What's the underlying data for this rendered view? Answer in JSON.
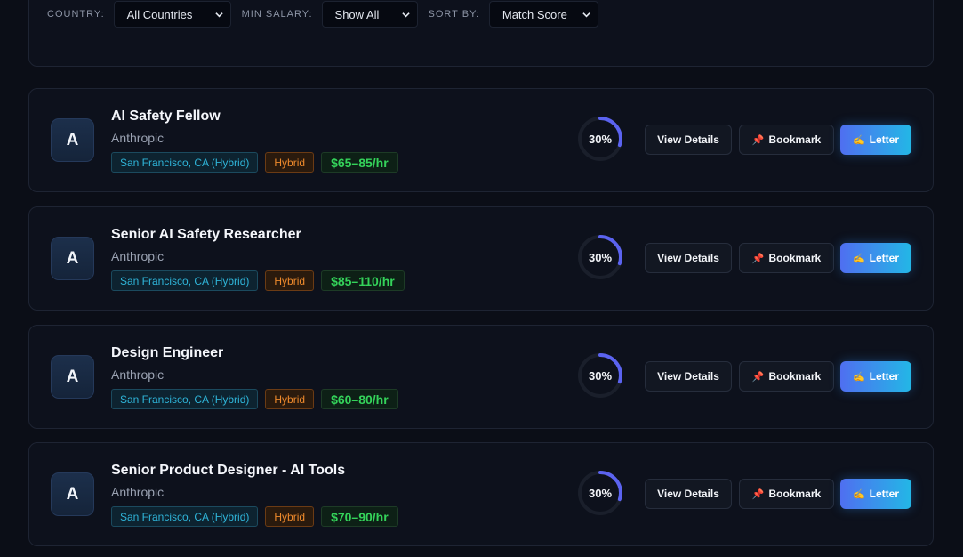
{
  "filters": {
    "country_label": "COUNTRY:",
    "country_value": "All Countries",
    "salary_label": "MIN SALARY:",
    "salary_value": "Show All",
    "sort_label": "SORT BY:",
    "sort_value": "Match Score"
  },
  "actions": {
    "view": "View Details",
    "bookmark": "Bookmark",
    "letter": "Letter",
    "bookmark_icon": "📌",
    "letter_icon": "✍️"
  },
  "colors": {
    "accent_gradient_start": "#4f6ff0",
    "accent_gradient_end": "#23b7e6",
    "ring_progress": "#5b63f0",
    "salary_green": "#34d35a",
    "hybrid_orange": "#ef8a2c",
    "location_cyan": "#2fb4d8"
  },
  "jobs": [
    {
      "avatar": "A",
      "title": "AI Safety Fellow",
      "company": "Anthropic",
      "location": "San Francisco, CA (Hybrid)",
      "mode": "Hybrid",
      "pay": "$65–85/hr",
      "match_label": "30%",
      "match": 30
    },
    {
      "avatar": "A",
      "title": "Senior AI Safety Researcher",
      "company": "Anthropic",
      "location": "San Francisco, CA (Hybrid)",
      "mode": "Hybrid",
      "pay": "$85–110/hr",
      "match_label": "30%",
      "match": 30
    },
    {
      "avatar": "A",
      "title": "Design Engineer",
      "company": "Anthropic",
      "location": "San Francisco, CA (Hybrid)",
      "mode": "Hybrid",
      "pay": "$60–80/hr",
      "match_label": "30%",
      "match": 30
    },
    {
      "avatar": "A",
      "title": "Senior Product Designer - AI Tools",
      "company": "Anthropic",
      "location": "San Francisco, CA (Hybrid)",
      "mode": "Hybrid",
      "pay": "$70–90/hr",
      "match_label": "30%",
      "match": 30
    }
  ]
}
